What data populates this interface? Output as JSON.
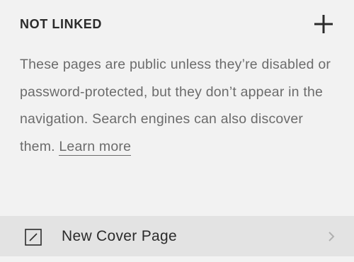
{
  "section": {
    "title": "NOT LINKED",
    "add_icon": "plus-icon"
  },
  "description": {
    "text": "These pages are public unless they’re disabled or password-protected, but they don’t appear in the navigation. Search engines can also discover them. ",
    "link_label": "Learn more"
  },
  "pages": [
    {
      "title": "New Cover Page",
      "icon": "cover-page-icon",
      "chevron_icon": "chevron-right-icon"
    }
  ],
  "colors": {
    "background": "#f2f2f2",
    "row_background": "#e3e3e3",
    "text": "#2b2b2b",
    "muted_text": "#6b6b6b",
    "chevron": "#b0b0b0"
  }
}
